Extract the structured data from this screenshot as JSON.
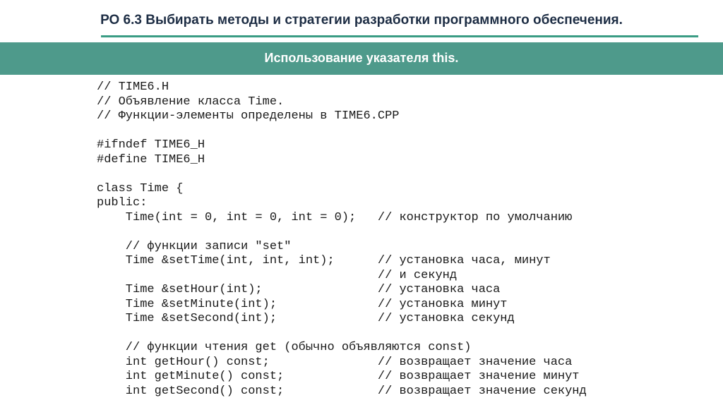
{
  "header": {
    "title": "РО 6.3 Выбирать методы и стратегии разработки программного обеспечения.",
    "banner": "Использование указателя this."
  },
  "code": {
    "lines": [
      "// TIME6.H",
      "// Объявление класса Time.",
      "// Функции-элементы определены в TIME6.CPP",
      "",
      "#ifndef TIME6_H",
      "#define TIME6_H",
      "",
      "class Time {",
      "public:",
      "    Time(int = 0, int = 0, int = 0);   // конструктор по умолчанию",
      "",
      "    // функции записи \"set\"",
      "    Time &setTime(int, int, int);      // установка часа, минут",
      "                                       // и секунд",
      "    Time &setHour(int);                // установка часа",
      "    Time &setMinute(int);              // установка минут",
      "    Time &setSecond(int);              // установка секунд",
      "",
      "    // функции чтения get (обычно объявляются const)",
      "    int getHour() const;               // возвращает значение часа",
      "    int getMinute() const;             // возвращает значение минут",
      "    int getSecond() const;             // возвращает значение секунд"
    ]
  }
}
